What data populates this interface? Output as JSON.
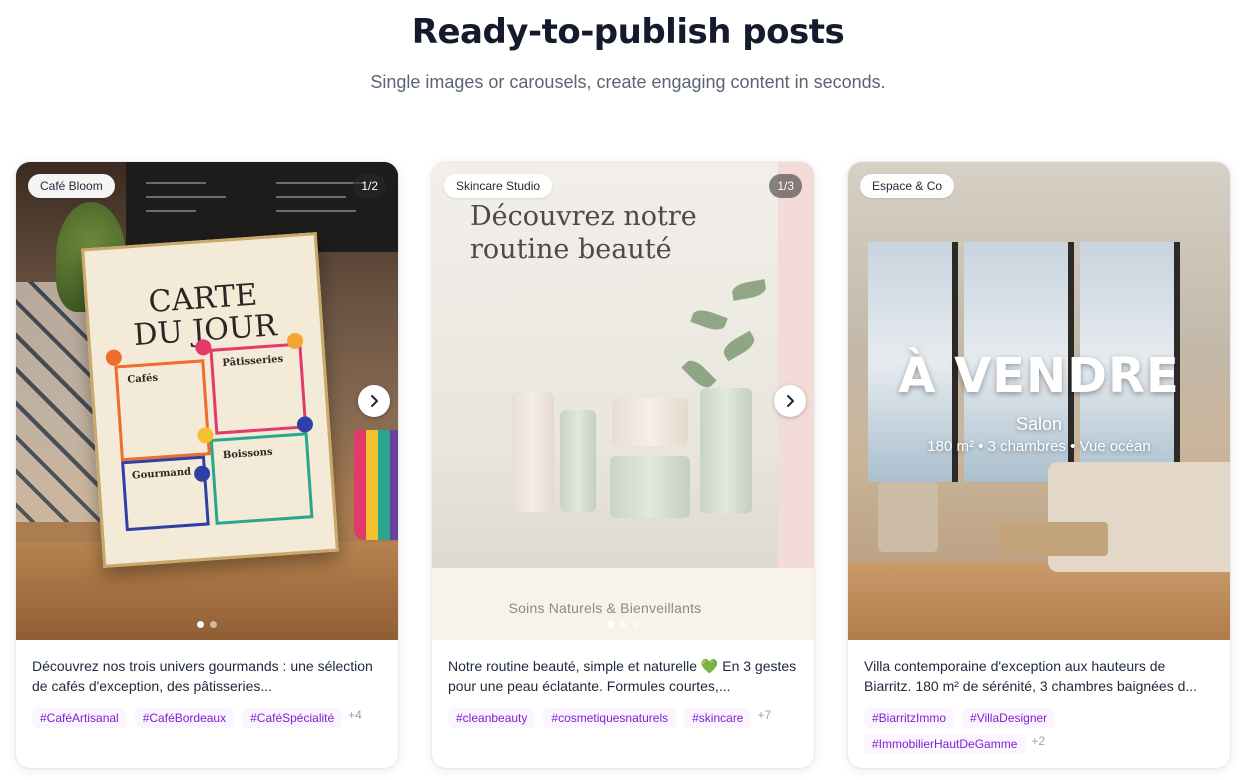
{
  "section": {
    "title": "Ready-to-publish posts",
    "subtitle": "Single images or carousels, create engaging content in seconds."
  },
  "posts": [
    {
      "brand": "Café Bloom",
      "counter": "1/2",
      "image": {
        "title_line1": "CARTE",
        "title_line2": "DU JOUR",
        "sections": [
          "Cafés",
          "Pâtisseries",
          "Gourmand",
          "Boissons"
        ]
      },
      "caption": "Découvrez nos trois univers gourmands : une sélection de cafés d'exception, des pâtisseries...",
      "tags": [
        "#CaféArtisanal",
        "#CaféBordeaux",
        "#CaféSpécialité"
      ],
      "more": "+4",
      "slides": 2,
      "active_slide": 1
    },
    {
      "brand": "Skincare Studio",
      "counter": "1/3",
      "image": {
        "headline_line1": "Découvrez notre",
        "headline_line2": "routine beauté",
        "footer": "Soins Naturels & Bienveillants"
      },
      "caption": "Notre routine beauté, simple et naturelle 💚 En 3 gestes pour une peau éclatante. Formules courtes,...",
      "tags": [
        "#cleanbeauty",
        "#cosmetiquesnaturels",
        "#skincare"
      ],
      "more": "+7",
      "slides": 3,
      "active_slide": 1
    },
    {
      "brand": "Espace & Co",
      "image": {
        "title": "À VENDRE",
        "room": "Salon",
        "details": "180 m² • 3 chambres • Vue océan"
      },
      "caption": "Villa contemporaine d'exception aux hauteurs de Biarritz. 180 m² de sérénité, 3 chambres baignées d...",
      "tags": [
        "#BiarritzImmo",
        "#VillaDesigner",
        "#ImmobilierHautDeGamme"
      ],
      "more": "+2"
    }
  ],
  "icons": {
    "next": "chevron-right-icon"
  },
  "colors": {
    "tag_text": "#7e22ce",
    "tag_bg": "#faf5ff",
    "heading": "#151a2d"
  }
}
